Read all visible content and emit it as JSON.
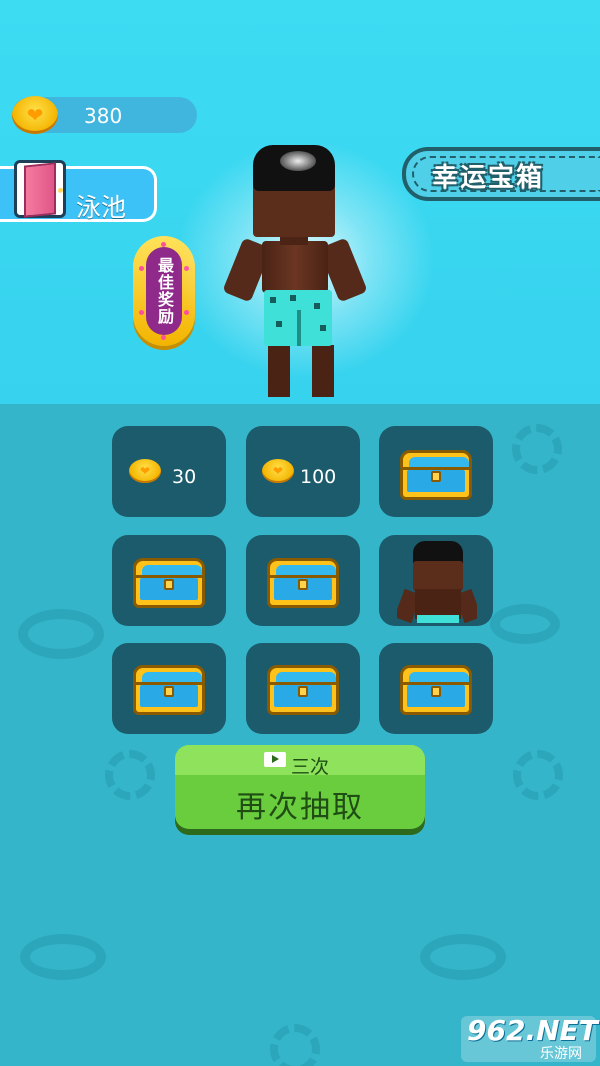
{
  "header": {
    "coins": "380"
  },
  "pool_button": {
    "label": "泳池"
  },
  "best_reward": {
    "label": "最佳奖励"
  },
  "lucky_chest": {
    "title": "幸运宝箱"
  },
  "grid": {
    "cells": [
      {
        "type": "coins",
        "amount": "30"
      },
      {
        "type": "coins",
        "amount": "100"
      },
      {
        "type": "chest"
      },
      {
        "type": "chest"
      },
      {
        "type": "chest"
      },
      {
        "type": "character"
      },
      {
        "type": "chest"
      },
      {
        "type": "chest"
      },
      {
        "type": "chest"
      }
    ]
  },
  "draw_button": {
    "times_label": "三次",
    "label": "再次抽取"
  },
  "watermark": {
    "main": "962.NET",
    "sub": "乐游网"
  },
  "colors": {
    "sky": "#3ddcf3",
    "pool": "#35b5ca",
    "cell": "#1b5b6b",
    "button_green": "#6acd3e",
    "coin_gold": "#f4b400"
  }
}
